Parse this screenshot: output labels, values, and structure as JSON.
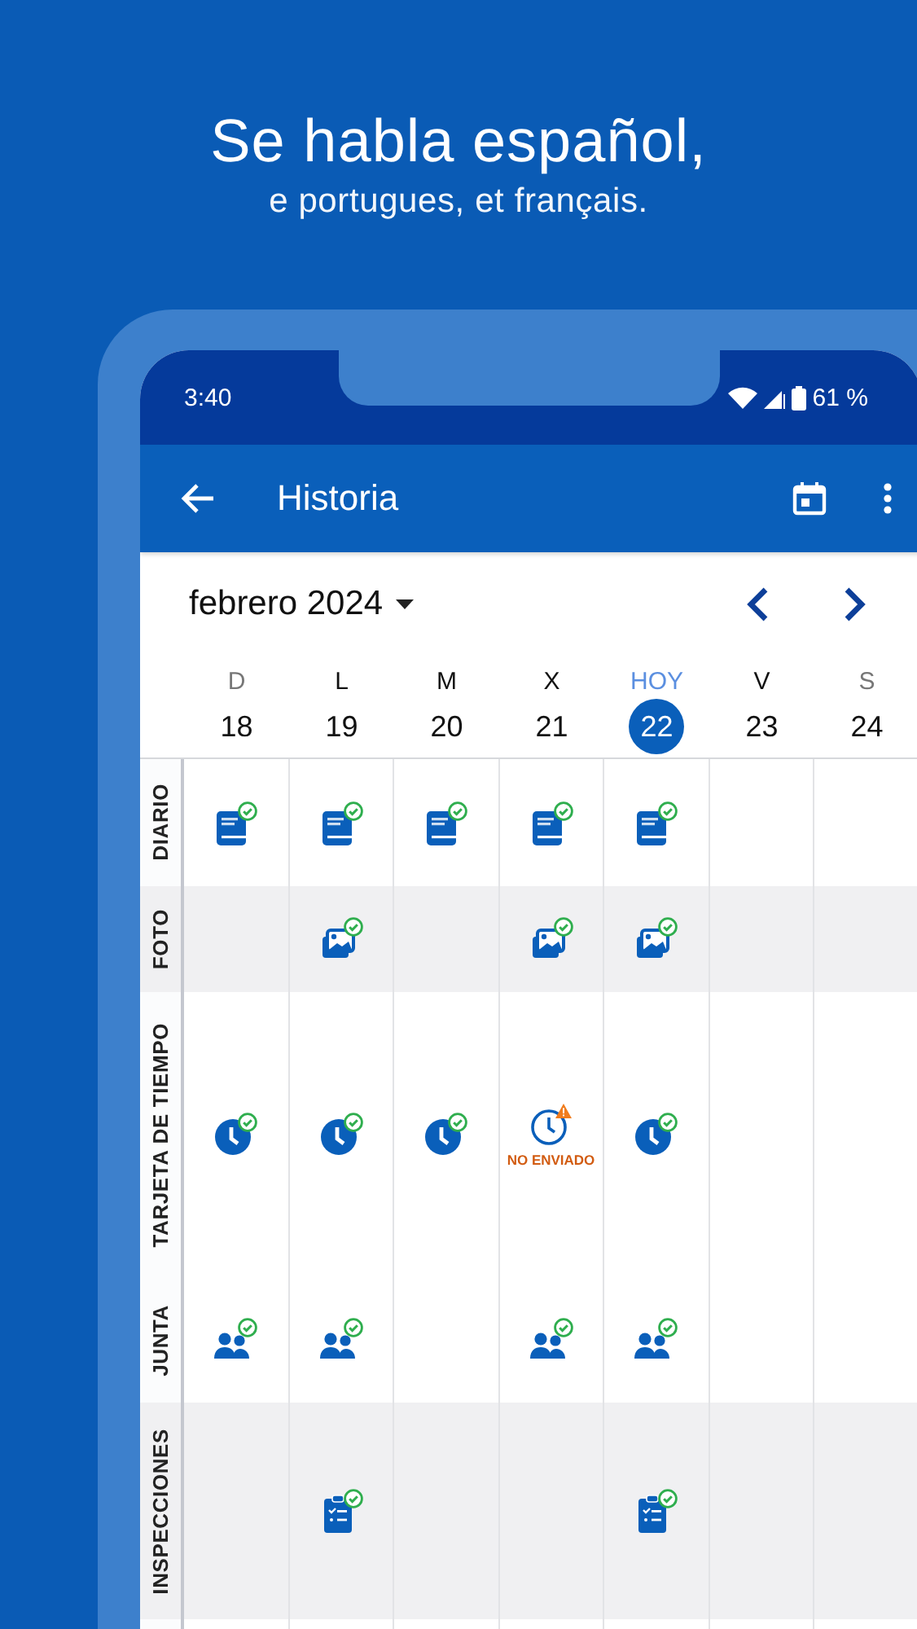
{
  "headline": {
    "title": "Se habla español,",
    "subtitle": "e portugues, et français."
  },
  "status_bar": {
    "time": "3:40",
    "battery": "61 %"
  },
  "app_bar": {
    "title": "Historia"
  },
  "calendar": {
    "month": "febrero 2024",
    "days": [
      {
        "letter": "D",
        "number": "18",
        "weekend": true,
        "today": false
      },
      {
        "letter": "L",
        "number": "19",
        "weekend": false,
        "today": false
      },
      {
        "letter": "M",
        "number": "20",
        "weekend": false,
        "today": false
      },
      {
        "letter": "X",
        "number": "21",
        "weekend": false,
        "today": false
      },
      {
        "letter": "HOY",
        "number": "22",
        "weekend": false,
        "today": true
      },
      {
        "letter": "V",
        "number": "23",
        "weekend": false,
        "today": false
      },
      {
        "letter": "S",
        "number": "24",
        "weekend": true,
        "today": false
      }
    ]
  },
  "rows": [
    {
      "label": "DIARIO",
      "kind": "diary",
      "shaded": false,
      "cells": [
        {
          "kind": "done"
        },
        {
          "kind": "done"
        },
        {
          "kind": "done"
        },
        {
          "kind": "done"
        },
        {
          "kind": "done"
        },
        {
          "kind": "empty"
        },
        {
          "kind": "empty"
        }
      ]
    },
    {
      "label": "FOTO",
      "kind": "photo",
      "shaded": true,
      "cells": [
        {
          "kind": "empty"
        },
        {
          "kind": "done"
        },
        {
          "kind": "empty"
        },
        {
          "kind": "done"
        },
        {
          "kind": "done"
        },
        {
          "kind": "empty"
        },
        {
          "kind": "empty"
        }
      ]
    },
    {
      "label": "TARJETA DE TIEMPO",
      "kind": "timecard",
      "shaded": false,
      "cells": [
        {
          "kind": "done"
        },
        {
          "kind": "done"
        },
        {
          "kind": "done"
        },
        {
          "kind": "unsent",
          "note": "NO ENVIADO"
        },
        {
          "kind": "done"
        },
        {
          "kind": "empty"
        },
        {
          "kind": "empty"
        }
      ]
    },
    {
      "label": "JUNTA",
      "kind": "meeting",
      "shaded": false,
      "cells": [
        {
          "kind": "done"
        },
        {
          "kind": "done"
        },
        {
          "kind": "empty"
        },
        {
          "kind": "done"
        },
        {
          "kind": "done"
        },
        {
          "kind": "empty"
        },
        {
          "kind": "empty"
        }
      ]
    },
    {
      "label": "INSPECCIONES",
      "kind": "inspection",
      "shaded": true,
      "cells": [
        {
          "kind": "empty"
        },
        {
          "kind": "done"
        },
        {
          "kind": "empty"
        },
        {
          "kind": "empty"
        },
        {
          "kind": "done"
        },
        {
          "kind": "empty"
        },
        {
          "kind": "empty"
        }
      ]
    }
  ]
}
